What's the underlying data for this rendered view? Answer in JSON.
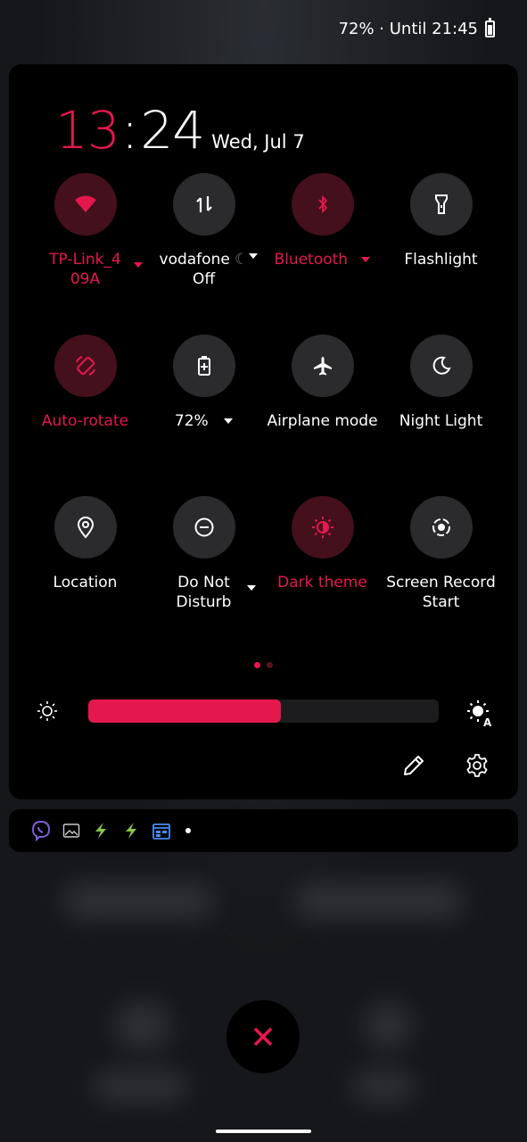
{
  "status_bar": {
    "text": "72% · Until 21:45"
  },
  "clock": {
    "hours": "13",
    "colon": ":",
    "minutes": "24",
    "date": "Wed, Jul 7"
  },
  "colors": {
    "accent": "#e5184d",
    "active_bg": "#44101b",
    "inactive_bg": "#2b2b2e"
  },
  "tiles": [
    {
      "label": "TP-Link_4 09A",
      "icon": "wifi-icon",
      "active": true,
      "has_dropdown": true
    },
    {
      "label": "vodafone",
      "sublabel": "Off",
      "icon": "mobile-data-icon",
      "active": false,
      "has_dropdown": true
    },
    {
      "label": "Bluetooth",
      "icon": "bluetooth-icon",
      "active": true,
      "has_dropdown": true
    },
    {
      "label": "Flashlight",
      "icon": "flashlight-icon",
      "active": false
    },
    {
      "label": "Auto-rotate",
      "icon": "auto-rotate-icon",
      "active": true
    },
    {
      "label": "72%",
      "icon": "battery-saver-icon",
      "active": false,
      "has_dropdown": true
    },
    {
      "label": "Airplane mode",
      "icon": "airplane-icon",
      "active": false
    },
    {
      "label": "Night Light",
      "icon": "moon-icon",
      "active": false
    },
    {
      "label": "Location",
      "icon": "location-icon",
      "active": false
    },
    {
      "label": "Do Not",
      "sublabel": "Disturb",
      "icon": "do-not-disturb-icon",
      "active": false,
      "has_dropdown": true
    },
    {
      "label": "Dark theme",
      "icon": "dark-theme-icon",
      "active": true
    },
    {
      "label": "Screen Record",
      "sublabel": "Start",
      "icon": "screen-record-icon",
      "active": false
    }
  ],
  "page_indicator": {
    "pages": 2,
    "current": 1
  },
  "brightness": {
    "level": 0.55,
    "auto": true
  },
  "notification_icons": [
    "viber-icon",
    "gallery-icon",
    "lightning-app-icon",
    "lightning-app-icon",
    "calendar-icon",
    "more-dot-icon"
  ]
}
